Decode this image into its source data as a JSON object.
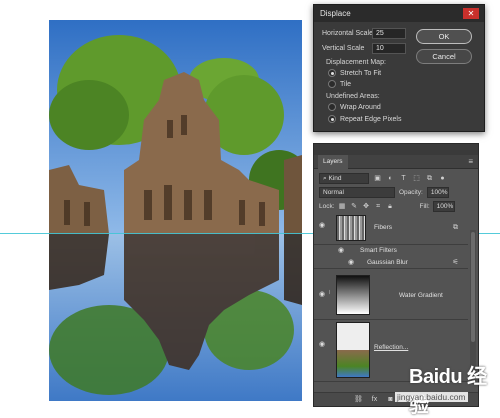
{
  "dialog": {
    "title": "Displace",
    "close_icon": "close-icon",
    "horizontal_label": "Horizontal Scale",
    "horizontal_value": "25",
    "vertical_label": "Vertical Scale",
    "vertical_value": "10",
    "map_group": "Displacement Map:",
    "map_opt1": "Stretch To Fit",
    "map_opt2": "Tile",
    "undefined_group": "Undefined Areas:",
    "undef_opt1": "Wrap Around",
    "undef_opt2": "Repeat Edge Pixels",
    "ok_label": "OK",
    "cancel_label": "Cancel"
  },
  "layers": {
    "tab": "Layers",
    "kind_label": "Kind",
    "blend_mode": "Normal",
    "opacity_label": "Opacity:",
    "opacity_value": "100%",
    "lock_label": "Lock:",
    "fill_label": "Fill:",
    "fill_value": "100%",
    "items": [
      {
        "name": "Fibers"
      },
      {
        "name": "Smart Filters"
      },
      {
        "name": "Gaussian Blur"
      },
      {
        "name": "Water Gradient"
      },
      {
        "name": "Reflection..."
      }
    ]
  },
  "watermark": {
    "text": "Baidu 经验",
    "url": "jingyan.baidu.com"
  }
}
